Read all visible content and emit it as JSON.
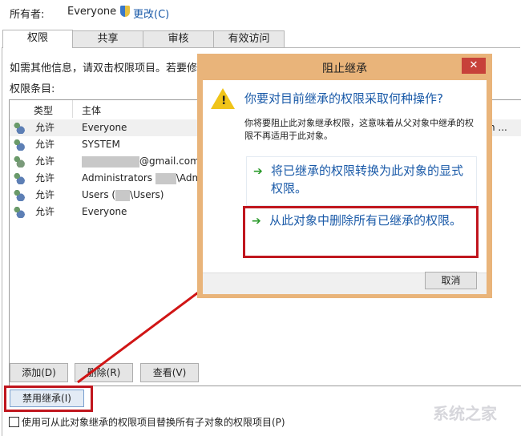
{
  "owner": {
    "label": "所有者:",
    "value": "Everyone",
    "change": "更改(C)"
  },
  "tabs": [
    "权限",
    "共享",
    "审核",
    "有效访问"
  ],
  "info": "如需其他信息，请双击权限项目。若要修",
  "entries_label": "权限条目:",
  "columns": [
    "类型",
    "主体"
  ],
  "rows": [
    {
      "type": "允许",
      "principal": "Everyone",
      "icon": "group-icon"
    },
    {
      "type": "允许",
      "principal": "SYSTEM",
      "icon": "group-icon"
    },
    {
      "type": "允许",
      "principal": "@gmail.com",
      "icon": "user-icon"
    },
    {
      "type": "允许",
      "principal": "Administrators",
      "suffix": "\\Admi",
      "icon": "group-icon"
    },
    {
      "type": "允许",
      "principal": "Users (",
      "suffix": "\\Users)",
      "icon": "group-icon"
    },
    {
      "type": "允许",
      "principal": "Everyone",
      "icon": "group-icon"
    }
  ],
  "row_overflow": "n ...",
  "buttons": {
    "add": "添加(D)",
    "remove": "删除(R)",
    "view": "查看(V)",
    "disable_inheritance": "禁用继承(I)"
  },
  "checkbox": {
    "label": "使用可从此对象继承的权限项目替换所有子对象的权限项目(P)",
    "checked": false
  },
  "dialog": {
    "title": "阻止继承",
    "heading": "你要对目前继承的权限采取何种操作?",
    "description": "你将要阻止此对象继承权限，这意味着从父对象中继承的权限不再适用于此对象。",
    "option1": "将已继承的权限转换为此对象的显式权限。",
    "option2": "从此对象中删除所有已继承的权限。",
    "cancel": "取消"
  },
  "watermark": "系统之家",
  "colors": {
    "dialog_frame": "#e9b47a",
    "link_blue": "#1a5aa8",
    "highlight_red": "#c0161e",
    "close_red": "#c7413a"
  }
}
